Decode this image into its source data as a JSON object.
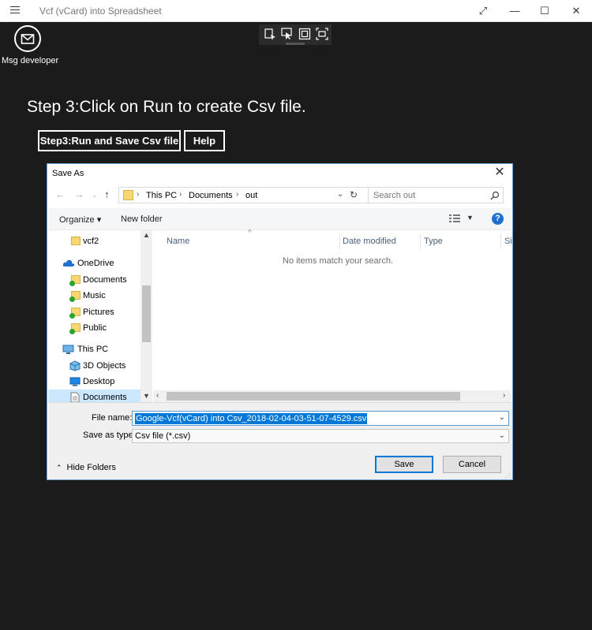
{
  "window": {
    "title": "Vcf (vCard) into Spreadsheet",
    "minimize": "—",
    "maximize": "☐",
    "close": "✕",
    "expand": "⤢"
  },
  "app": {
    "msg_developer": "Msg developer",
    "step_text": "Step 3:Click on Run to create Csv file.",
    "run_button": "Step3:Run and Save Csv file",
    "help_button": "Help"
  },
  "dialog": {
    "title": "Save As",
    "breadcrumb": [
      "This PC",
      "Documents",
      "out"
    ],
    "search_placeholder": "Search out",
    "organize": "Organize ▾",
    "new_folder": "New folder",
    "nav_items": [
      {
        "label": "vcf2",
        "icon": "folder-icon"
      },
      {
        "label": "OneDrive",
        "icon": "cloud-icon"
      },
      {
        "label": "Documents",
        "icon": "folder-icon"
      },
      {
        "label": "Music",
        "icon": "folder-icon"
      },
      {
        "label": "Pictures",
        "icon": "folder-icon"
      },
      {
        "label": "Public",
        "icon": "folder-icon"
      },
      {
        "label": "This PC",
        "icon": "computer-icon"
      },
      {
        "label": "3D Objects",
        "icon": "cube-icon"
      },
      {
        "label": "Desktop",
        "icon": "desktop-icon"
      },
      {
        "label": "Documents",
        "icon": "document-icon"
      }
    ],
    "columns": [
      "Name",
      "Date modified",
      "Type",
      "Si"
    ],
    "empty_message": "No items match your search.",
    "file_name_label": "File name:",
    "file_name_value": "Google-Vcf(vCard) into Csv_2018-02-04-03-51-07-4529.csv",
    "save_type_label": "Save as type:",
    "save_type_value": "Csv file (*.csv)",
    "hide_folders": "Hide Folders",
    "save": "Save",
    "cancel": "Cancel"
  },
  "colors": {
    "app_bg": "#1b1b1b",
    "accent": "#0078d7",
    "selection": "#cce8ff"
  }
}
